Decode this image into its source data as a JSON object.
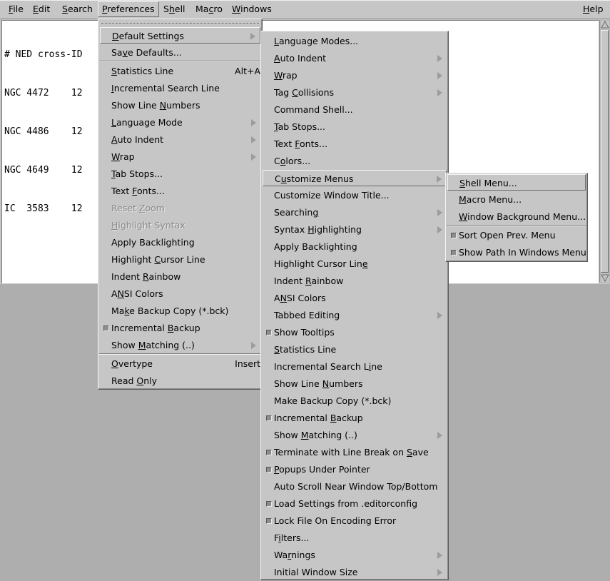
{
  "menubar": {
    "items": [
      {
        "pre": "",
        "u": "F",
        "post": "ile"
      },
      {
        "pre": "",
        "u": "E",
        "post": "dit"
      },
      {
        "pre": "",
        "u": "S",
        "post": "earch"
      },
      {
        "pre": "",
        "u": "P",
        "post": "references"
      },
      {
        "pre": "S",
        "u": "h",
        "post": "ell"
      },
      {
        "pre": "Ma",
        "u": "c",
        "post": "ro"
      },
      {
        "pre": "",
        "u": "W",
        "post": "indows"
      },
      {
        "pre": "",
        "u": "H",
        "post": "elp"
      }
    ]
  },
  "document": {
    "lines": [
      "# NED cross-ID",
      "NGC 4472    12",
      "NGC 4486    12",
      "NGC 4649    12",
      "IC  3583    12"
    ]
  },
  "preferences_menu": {
    "items": [
      {
        "pre": "",
        "u": "D",
        "post": "efault Settings",
        "accel": "",
        "submenu": true,
        "checked": false,
        "disabled": false,
        "highlight": true
      },
      {
        "pre": "Sa",
        "u": "v",
        "post": "e Defaults...",
        "accel": "",
        "submenu": false,
        "checked": false,
        "disabled": false
      },
      {
        "pre": "",
        "u": "S",
        "post": "tatistics Line",
        "accel": "Alt+A",
        "submenu": false,
        "checked": false,
        "disabled": false
      },
      {
        "pre": "",
        "u": "I",
        "post": "ncremental Search Line",
        "accel": "",
        "submenu": false,
        "checked": false,
        "disabled": false
      },
      {
        "pre": "Show Line ",
        "u": "N",
        "post": "umbers",
        "accel": "",
        "submenu": false,
        "checked": false,
        "disabled": false
      },
      {
        "pre": "",
        "u": "L",
        "post": "anguage Mode",
        "accel": "",
        "submenu": true,
        "checked": false,
        "disabled": false
      },
      {
        "pre": "",
        "u": "A",
        "post": "uto Indent",
        "accel": "",
        "submenu": true,
        "checked": false,
        "disabled": false
      },
      {
        "pre": "",
        "u": "W",
        "post": "rap",
        "accel": "",
        "submenu": true,
        "checked": false,
        "disabled": false
      },
      {
        "pre": "",
        "u": "T",
        "post": "ab Stops...",
        "accel": "",
        "submenu": false,
        "checked": false,
        "disabled": false
      },
      {
        "pre": "Text ",
        "u": "F",
        "post": "onts...",
        "accel": "",
        "submenu": false,
        "checked": false,
        "disabled": false
      },
      {
        "pre": "Reset ",
        "u": "Z",
        "post": "oom",
        "accel": "",
        "submenu": false,
        "checked": false,
        "disabled": true
      },
      {
        "pre": "",
        "u": "H",
        "post": "ighlight Syntax",
        "accel": "",
        "submenu": false,
        "checked": false,
        "disabled": true
      },
      {
        "pre": "Apply Backlighting",
        "u": "",
        "post": "",
        "accel": "",
        "submenu": false,
        "checked": false,
        "disabled": false
      },
      {
        "pre": "Highlight ",
        "u": "C",
        "post": "ursor Line",
        "accel": "",
        "submenu": false,
        "checked": false,
        "disabled": false
      },
      {
        "pre": "Indent ",
        "u": "R",
        "post": "ainbow",
        "accel": "",
        "submenu": false,
        "checked": false,
        "disabled": false
      },
      {
        "pre": "A",
        "u": "N",
        "post": "SI Colors",
        "accel": "",
        "submenu": false,
        "checked": false,
        "disabled": false
      },
      {
        "pre": "Ma",
        "u": "k",
        "post": "e Backup Copy (*.bck)",
        "accel": "",
        "submenu": false,
        "checked": false,
        "disabled": false
      },
      {
        "pre": "Incremental ",
        "u": "B",
        "post": "ackup",
        "accel": "",
        "submenu": false,
        "checked": true,
        "disabled": false
      },
      {
        "pre": "Show ",
        "u": "M",
        "post": "atching (..)",
        "accel": "",
        "submenu": true,
        "checked": false,
        "disabled": false
      },
      {
        "pre": "",
        "u": "O",
        "post": "vertype",
        "accel": "Insert",
        "submenu": false,
        "checked": false,
        "disabled": false
      },
      {
        "pre": "Read ",
        "u": "O",
        "post": "nly",
        "accel": "",
        "submenu": false,
        "checked": false,
        "disabled": false
      }
    ]
  },
  "default_settings_menu": {
    "items": [
      {
        "pre": "",
        "u": "L",
        "post": "anguage Modes...",
        "submenu": false,
        "checked": false
      },
      {
        "pre": "",
        "u": "A",
        "post": "uto Indent",
        "submenu": true,
        "checked": false
      },
      {
        "pre": "",
        "u": "W",
        "post": "rap",
        "submenu": true,
        "checked": false
      },
      {
        "pre": "Tag ",
        "u": "C",
        "post": "ollisions",
        "submenu": true,
        "checked": false
      },
      {
        "pre": "Command Shell...",
        "u": "",
        "post": "",
        "submenu": false,
        "checked": false
      },
      {
        "pre": "",
        "u": "T",
        "post": "ab Stops...",
        "submenu": false,
        "checked": false
      },
      {
        "pre": "Text ",
        "u": "F",
        "post": "onts...",
        "submenu": false,
        "checked": false
      },
      {
        "pre": "C",
        "u": "o",
        "post": "lors...",
        "submenu": false,
        "checked": false
      },
      {
        "pre": "C",
        "u": "u",
        "post": "stomize Menus",
        "submenu": true,
        "checked": false,
        "highlight": true
      },
      {
        "pre": "Customize Window Title...",
        "u": "",
        "post": "",
        "submenu": false,
        "checked": false
      },
      {
        "pre": "Searchin",
        "u": "g",
        "post": "",
        "submenu": true,
        "checked": false
      },
      {
        "pre": "Syntax ",
        "u": "H",
        "post": "ighlighting",
        "submenu": true,
        "checked": false
      },
      {
        "pre": "Apply Backlighting",
        "u": "",
        "post": "",
        "submenu": false,
        "checked": false
      },
      {
        "pre": "Highlight Cursor Lin",
        "u": "e",
        "post": "",
        "submenu": false,
        "checked": false
      },
      {
        "pre": "Indent ",
        "u": "R",
        "post": "ainbow",
        "submenu": false,
        "checked": false
      },
      {
        "pre": "A",
        "u": "N",
        "post": "SI Colors",
        "submenu": false,
        "checked": false
      },
      {
        "pre": "Tabbed Editing",
        "u": "",
        "post": "",
        "submenu": true,
        "checked": false
      },
      {
        "pre": "Show Tooltips",
        "u": "",
        "post": "",
        "submenu": false,
        "checked": true
      },
      {
        "pre": "",
        "u": "S",
        "post": "tatistics Line",
        "submenu": false,
        "checked": false
      },
      {
        "pre": "Incremental Search L",
        "u": "i",
        "post": "ne",
        "submenu": false,
        "checked": false
      },
      {
        "pre": "Show Line ",
        "u": "N",
        "post": "umbers",
        "submenu": false,
        "checked": false
      },
      {
        "pre": "Make Backup Copy (*.bck)",
        "u": "",
        "post": "",
        "submenu": false,
        "checked": false
      },
      {
        "pre": "Incremental ",
        "u": "B",
        "post": "ackup",
        "submenu": false,
        "checked": true
      },
      {
        "pre": "Show ",
        "u": "M",
        "post": "atching (..)",
        "submenu": true,
        "checked": false
      },
      {
        "pre": "Terminate with Line Break on ",
        "u": "S",
        "post": "ave",
        "submenu": false,
        "checked": true
      },
      {
        "pre": "",
        "u": "P",
        "post": "opups Under Pointer",
        "submenu": false,
        "checked": true
      },
      {
        "pre": "Auto Scroll Near Window Top/Bottom",
        "u": "",
        "post": "",
        "submenu": false,
        "checked": false
      },
      {
        "pre": "Load Settings from .editorconfig",
        "u": "",
        "post": "",
        "submenu": false,
        "checked": true
      },
      {
        "pre": "Lock File On Encoding Error",
        "u": "",
        "post": "",
        "submenu": false,
        "checked": true
      },
      {
        "pre": "F",
        "u": "i",
        "post": "lters...",
        "submenu": false,
        "checked": false
      },
      {
        "pre": "Wa",
        "u": "r",
        "post": "nings",
        "submenu": true,
        "checked": false
      },
      {
        "pre": "Initial Window Size",
        "u": "",
        "post": "",
        "submenu": true,
        "checked": false
      }
    ]
  },
  "customize_menus_menu": {
    "items": [
      {
        "pre": "",
        "u": "S",
        "post": "hell Menu...",
        "checked": false,
        "highlight": true
      },
      {
        "pre": "",
        "u": "M",
        "post": "acro Menu...",
        "checked": false
      },
      {
        "pre": "",
        "u": "W",
        "post": "indow Background Menu...",
        "checked": false
      },
      {
        "pre": "Sort Open Prev. Menu",
        "u": "",
        "post": "",
        "checked": true
      },
      {
        "pre": "Show Path In Windows Menu",
        "u": "",
        "post": "",
        "checked": true
      }
    ]
  }
}
